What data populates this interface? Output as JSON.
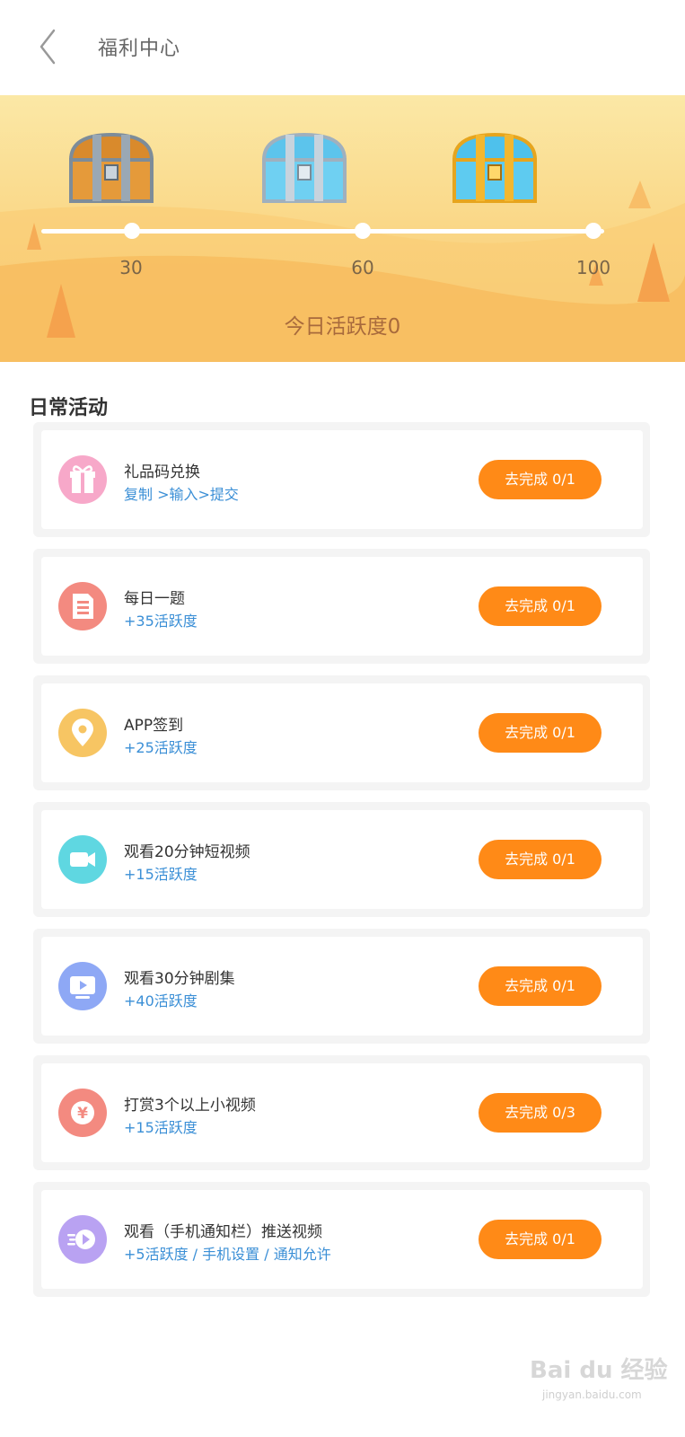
{
  "header": {
    "title": "福利中心",
    "back_icon": "chevron-left-icon"
  },
  "banner": {
    "chests": [
      {
        "name": "bronze-chest",
        "color": "#d98a2c"
      },
      {
        "name": "silver-chest",
        "color": "#5cc4ec"
      },
      {
        "name": "gold-chest",
        "color": "#f3b72f"
      }
    ],
    "milestones": [
      "30",
      "60",
      "100"
    ],
    "progress": 0,
    "activity_text": "今日活跃度0"
  },
  "section_title": "日常活动",
  "tasks": [
    {
      "title": "礼品码兑换",
      "subtitle": "复制 >输入>提交",
      "button": "去完成 0/1",
      "icon": "gift-icon",
      "icon_color": "#f7a8c9"
    },
    {
      "title": "每日一题",
      "subtitle": "+35活跃度",
      "button": "去完成 0/1",
      "icon": "document-icon",
      "icon_color": "#f38a80"
    },
    {
      "title": "APP签到",
      "subtitle": "+25活跃度",
      "button": "去完成 0/1",
      "icon": "location-pin-icon",
      "icon_color": "#f7c563"
    },
    {
      "title": "观看20分钟短视频",
      "subtitle": "+15活跃度",
      "button": "去完成 0/1",
      "icon": "video-camera-icon",
      "icon_color": "#5fd7e1"
    },
    {
      "title": "观看30分钟剧集",
      "subtitle": "+40活跃度",
      "button": "去完成 0/1",
      "icon": "tv-play-icon",
      "icon_color": "#8ea8f5"
    },
    {
      "title": "打赏3个以上小视频",
      "subtitle": "+15活跃度",
      "button": "去完成 0/3",
      "icon": "yuan-coin-icon",
      "icon_color": "#f38a80"
    },
    {
      "title": "观看（手机通知栏）推送视频",
      "subtitle": "+5活跃度 / 手机设置 / 通知允许",
      "button": "去完成 0/1",
      "icon": "push-play-icon",
      "icon_color": "#b9a2f2"
    }
  ],
  "accent_color": "#ff8a17",
  "watermark": {
    "text": "Bai du 经验",
    "sub": "jingyan.baidu.com"
  }
}
